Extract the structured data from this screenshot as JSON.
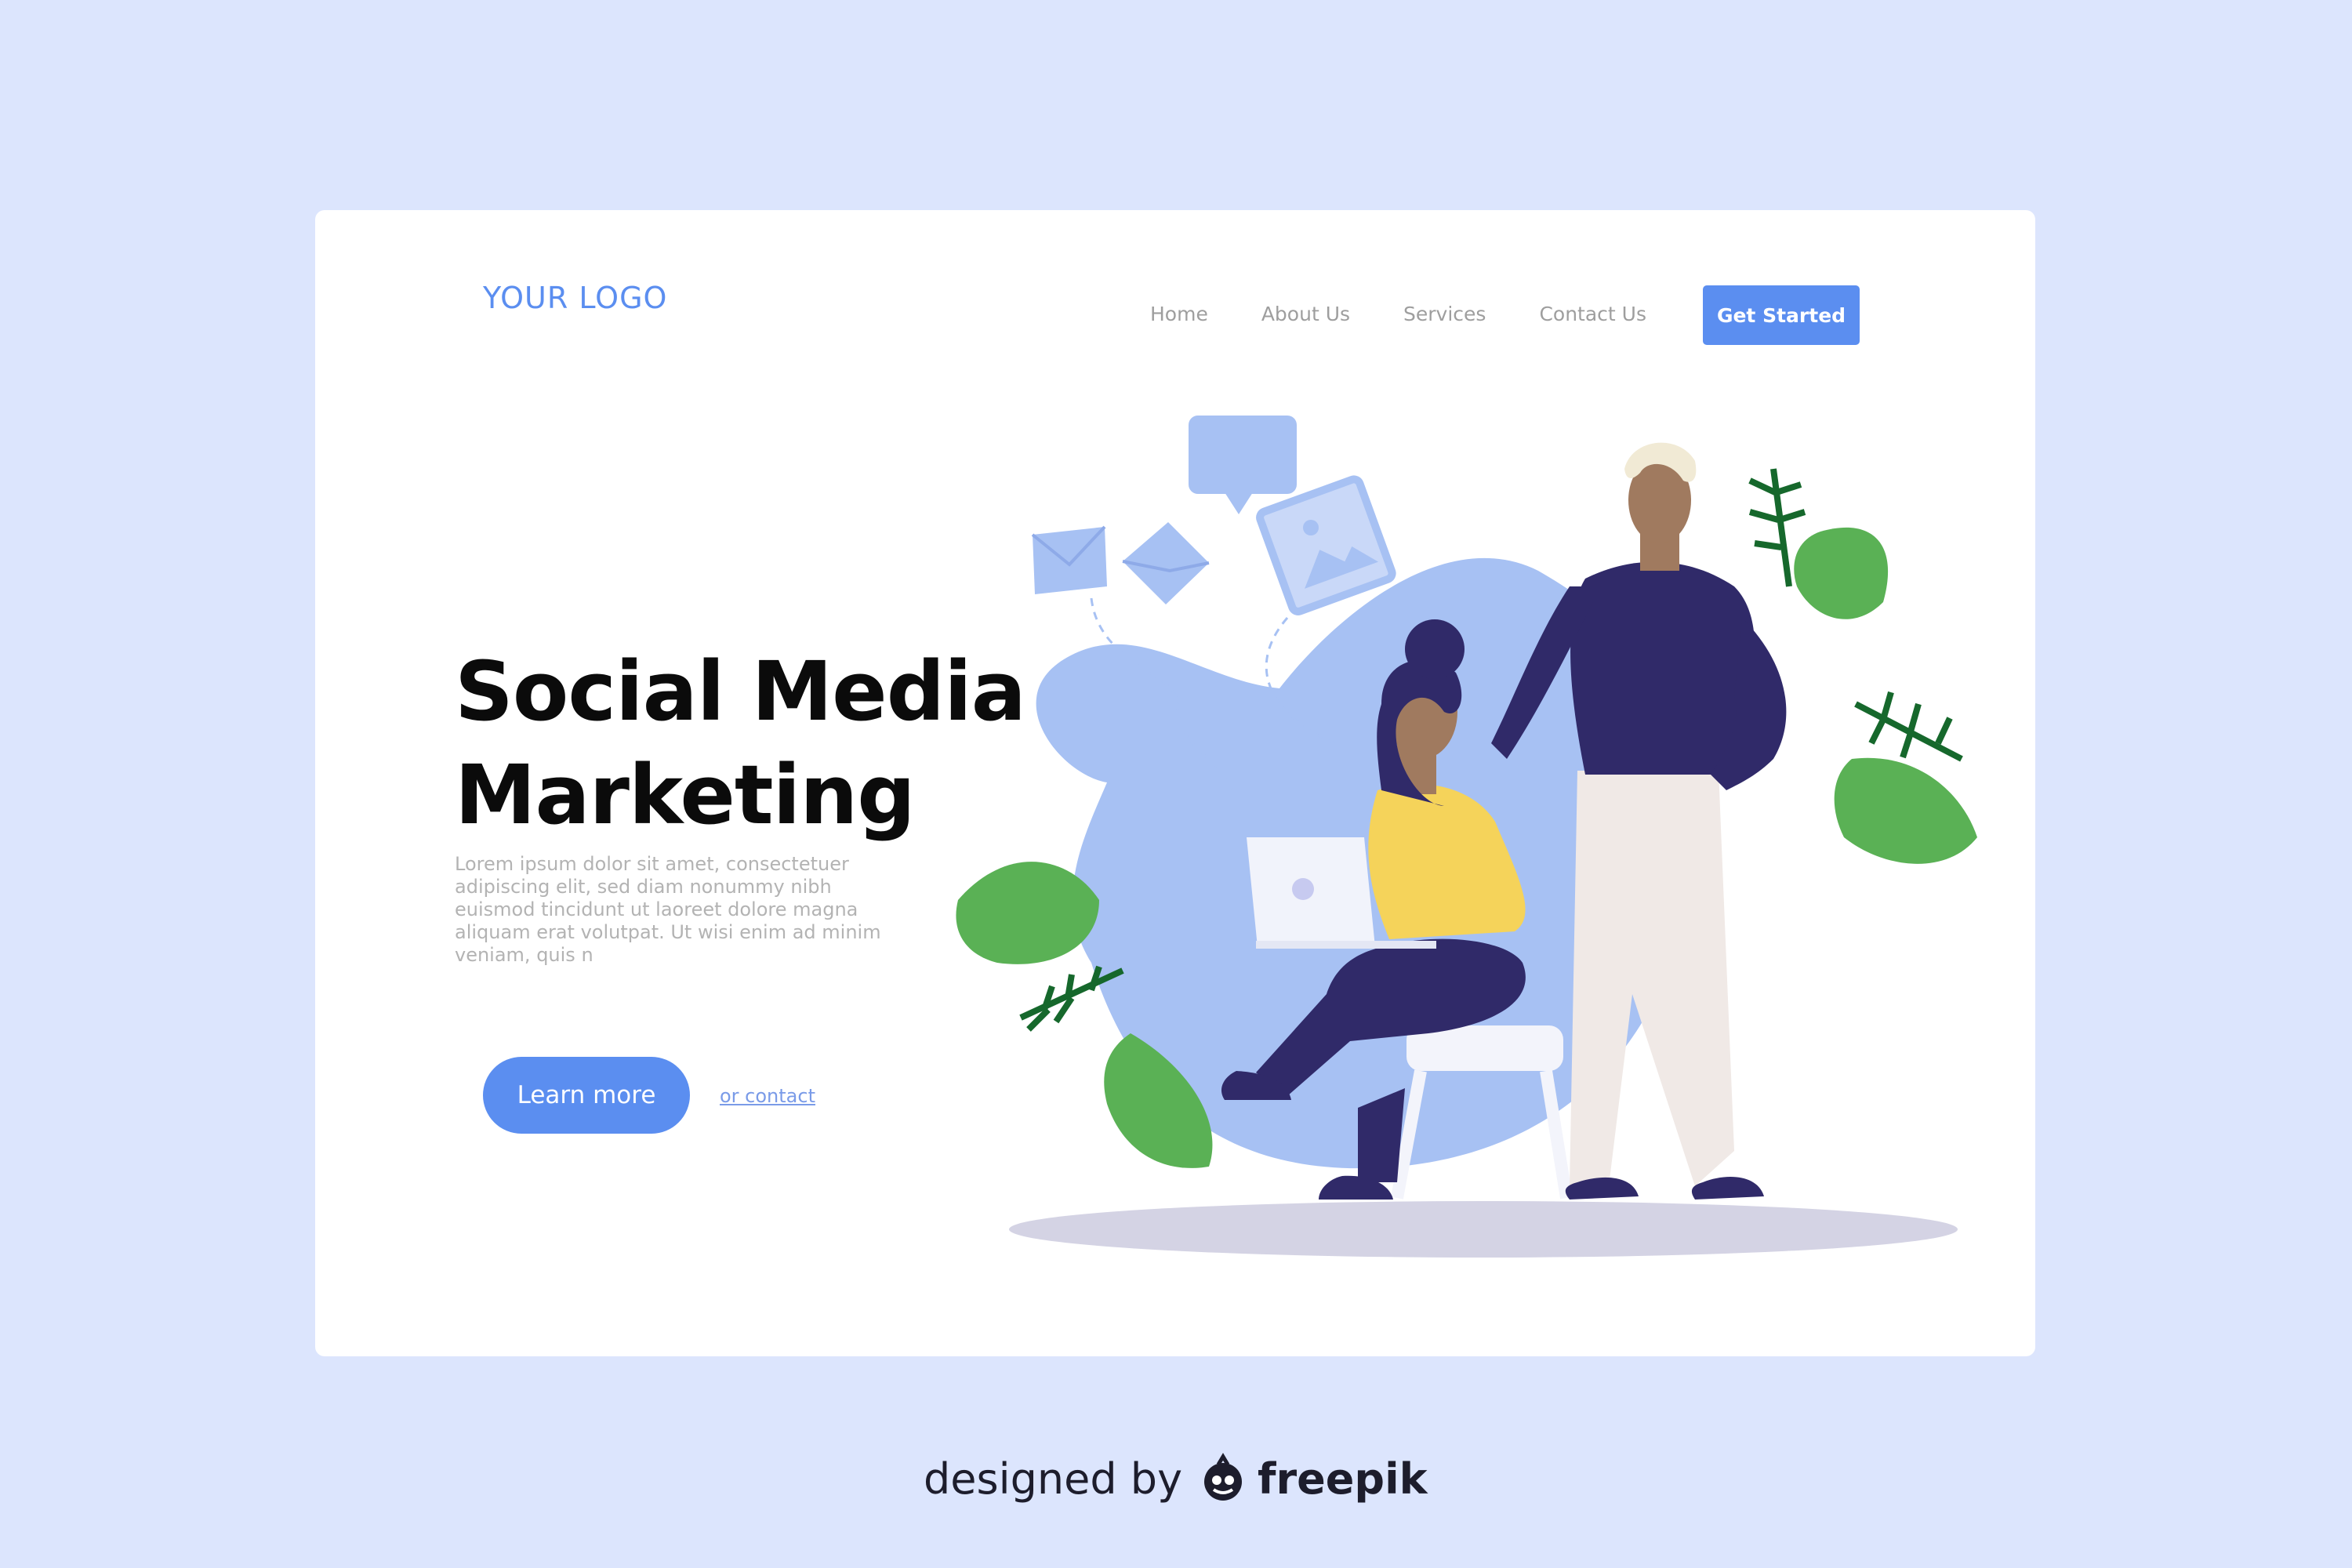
{
  "header": {
    "logo": "YOUR LOGO",
    "nav": [
      "Home",
      "About Us",
      "Services",
      "Contact Us"
    ],
    "cta": "Get Started"
  },
  "hero": {
    "title_line1": "Social Media",
    "title_line2": "Marketing",
    "description": "Lorem ipsum dolor sit amet, consectetuer adipiscing elit, sed diam nonummy nibh euismod tincidunt ut laoreet dolore magna aliquam erat volutpat. Ut wisi enim ad minim veniam, quis n",
    "primary_button": "Learn more",
    "secondary_link": "or contact"
  },
  "footer": {
    "credit_prefix": "designed by",
    "credit_brand": "freepik"
  },
  "icons": [
    "chat-bubble-icon",
    "envelope-icon",
    "image-icon",
    "freepik-logo-icon"
  ],
  "colors": {
    "page_background": "#dce5fd",
    "accent": "#5b8ef0",
    "title": "#0b0b0b"
  }
}
